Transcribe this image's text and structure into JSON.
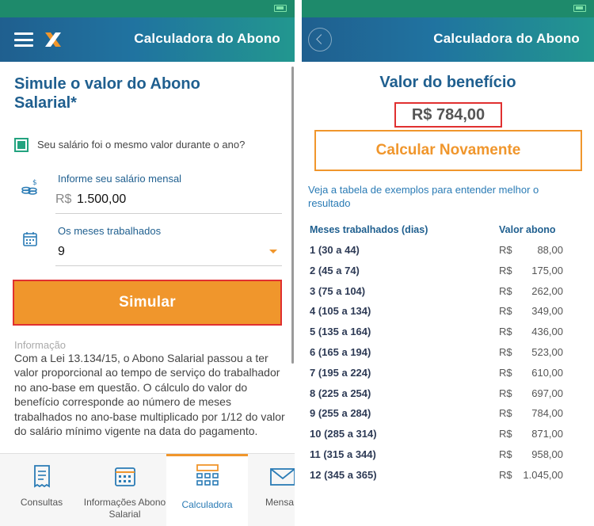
{
  "left": {
    "appbar_title": "Calculadora do Abono",
    "heading": "Simule o valor do Abono Salarial*",
    "same_salary_label": "Seu salário foi o mesmo valor durante o ano?",
    "salary": {
      "label": "Informe seu salário mensal",
      "currency": "R$",
      "value": "1.500,00"
    },
    "months": {
      "label": "Os meses trabalhados",
      "value": "9"
    },
    "simulate_button": "Simular",
    "info_title": "Informação",
    "info_text": "Com a Lei 13.134/15, o Abono Salarial passou a ter valor proporcional ao tempo de serviço do trabalhador no ano-base em questão. O cálculo do valor do benefício corresponde ao número de meses trabalhados no ano-base multiplicado por 1/12 do valor do salário mínimo vigente na data do pagamento.",
    "tabs": [
      {
        "label": "Consultas",
        "icon": "receipt-icon"
      },
      {
        "label": "Informações Abono Salarial",
        "icon": "calendar-icon"
      },
      {
        "label": "Calculadora",
        "icon": "calculator-icon",
        "active": true
      },
      {
        "label": "Mensa",
        "icon": "envelope-icon"
      }
    ]
  },
  "right": {
    "appbar_title": "Calculadora do Abono",
    "heading": "Valor do benefício",
    "amount": "R$ 784,00",
    "recalc_button": "Calcular Novamente",
    "hint": "Veja a tabela de exemplos para entender melhor o resultado",
    "table": {
      "col_months": "Meses trabalhados (dias)",
      "col_value": "Valor abono",
      "currency": "R$",
      "rows": [
        {
          "months": "1 (30 a 44)",
          "value": "88,00"
        },
        {
          "months": "2 (45 a 74)",
          "value": "175,00"
        },
        {
          "months": "3 (75 a 104)",
          "value": "262,00"
        },
        {
          "months": "4 (105 a 134)",
          "value": "349,00"
        },
        {
          "months": "5 (135 a 164)",
          "value": "436,00"
        },
        {
          "months": "6 (165 a 194)",
          "value": "523,00"
        },
        {
          "months": "7 (195 a 224)",
          "value": "610,00"
        },
        {
          "months": "8 (225 a 254)",
          "value": "697,00"
        },
        {
          "months": "9 (255 a 284)",
          "value": "784,00"
        },
        {
          "months": "10 (285 a 314)",
          "value": "871,00"
        },
        {
          "months": "11 (315 a 344)",
          "value": "958,00"
        },
        {
          "months": "12 (345 a 365)",
          "value": "1.045,00"
        }
      ]
    }
  },
  "colors": {
    "primary_blue": "#1f5f8f",
    "accent_orange": "#f0962c",
    "status_green": "#1e8a6b",
    "highlight_red": "#e03030"
  }
}
